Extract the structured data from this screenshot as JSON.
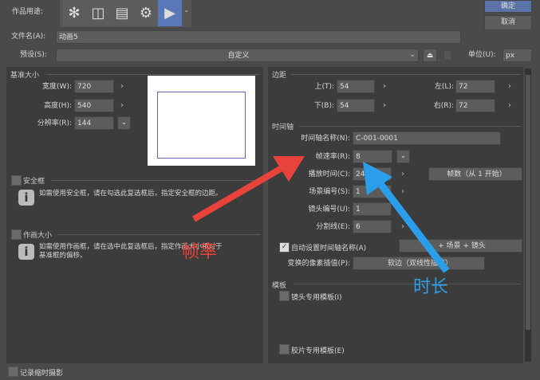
{
  "header": {
    "usage_label": "作品用途:",
    "usage_icons": [
      "illustration-icon",
      "comic-icon",
      "page-icon",
      "page-settings-icon",
      "animation-icon"
    ],
    "active_usage": "animation-icon",
    "ok": "确定",
    "cancel": "取消"
  },
  "file": {
    "label": "文件名(A):",
    "value": "动画5"
  },
  "preset": {
    "label": "预设(S):",
    "value": "自定义",
    "unit_label": "单位(U):",
    "unit_value": "px"
  },
  "base": {
    "title": "基准大小",
    "width_label": "宽度(W):",
    "width": "720",
    "height_label": "高度(H):",
    "height": "540",
    "res_label": "分辨率(R):",
    "res": "144"
  },
  "safe": {
    "label": "安全框",
    "info": "如需使用安全框，请在勾选此复选框后，指定安全框的边距。",
    "checked": false
  },
  "draw": {
    "label": "作画大小",
    "info1": "如需使用作画框，请在选中此复选框后，指定作画大小相对于",
    "info2": "基准框的偏移。",
    "checked": false
  },
  "margin": {
    "title": "边距",
    "top_label": "上(T):",
    "top": "54",
    "bottom_label": "下(B):",
    "bottom": "54",
    "left_label": "左(L):",
    "left": "72",
    "right_label": "右(R):",
    "right": "72"
  },
  "timeline": {
    "title": "时间轴",
    "name_label": "时间轴名称(N):",
    "name": "C-001-0001",
    "fps_label": "帧速率(R):",
    "fps": "8",
    "dur_label": "播放时间(C):",
    "dur": "24",
    "dur_mode": "帧数（从 1 开始）",
    "scene_label": "场景编号(S):",
    "scene": "1",
    "cut_label": "镜头编号(U):",
    "cut": "1",
    "div_label": "分割线(E):",
    "div": "6",
    "auto_label": "自动设置时间轴名称(A)",
    "auto_checked": true,
    "auto_value": "+ 场景 + 镜头",
    "interp_label": "变换的像素插值(P):",
    "interp": "软边（双线性插值）"
  },
  "template": {
    "title": "模板",
    "cut_label": "镜头专用模板(I)",
    "film_label": "胶片专用模板(E)"
  },
  "record": {
    "label": "记录缩时摄影"
  },
  "annotations": {
    "fps_note": "帧率",
    "dur_note": "时长",
    "red": "#e8433a",
    "blue": "#2a9ee8"
  }
}
